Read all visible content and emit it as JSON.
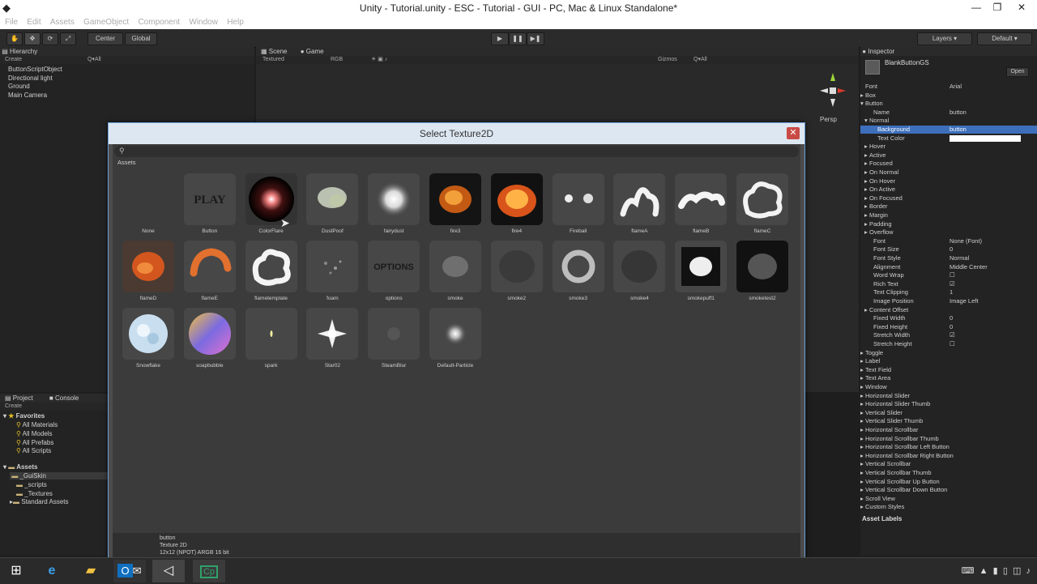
{
  "window": {
    "title": "Unity - Tutorial.unity - ESC - Tutorial - GUI - PC, Mac & Linux Standalone*",
    "menu": [
      "File",
      "Edit",
      "Assets",
      "GameObject",
      "Component",
      "Window",
      "Help"
    ]
  },
  "toolbar": {
    "pivot": "Center",
    "space": "Global",
    "layers": "Layers",
    "layout": "Default"
  },
  "hierarchy": {
    "tab": "Hierarchy",
    "create": "Create",
    "search_placeholder": "Q▾All",
    "items": [
      "ButtonScriptObject",
      "Directional light",
      "Ground",
      "Main Camera"
    ]
  },
  "scene": {
    "tab_scene": "Scene",
    "tab_game": "Game",
    "textured": "Textured",
    "rgb": "RGB",
    "gizmos": "Gizmos",
    "search": "Q▾All",
    "persp": "Persp"
  },
  "project": {
    "tab_project": "Project",
    "tab_console": "Console",
    "create": "Create",
    "favorites_label": "Favorites",
    "favorites": [
      "All Materials",
      "All Models",
      "All Prefabs",
      "All Scripts"
    ],
    "assets_label": "Assets",
    "assets": [
      "_GuiSkin",
      "_scripts",
      "_Textures",
      "Standard Assets"
    ]
  },
  "inspector": {
    "tab": "Inspector",
    "object_name": "BlankButtonGS",
    "open_button": "Open",
    "rows": [
      {
        "k": "Font",
        "v": "Arial",
        "indent": 0,
        "arrow": ""
      },
      {
        "k": "Box",
        "v": "",
        "indent": 0,
        "arrow": "▸"
      },
      {
        "k": "Button",
        "v": "",
        "indent": 0,
        "arrow": "▾"
      },
      {
        "k": "Name",
        "v": "button",
        "indent": 2,
        "arrow": ""
      },
      {
        "k": "Normal",
        "v": "",
        "indent": 1,
        "arrow": "▾"
      },
      {
        "k": "Background",
        "v": "button",
        "indent": 3,
        "arrow": "",
        "sel": true
      },
      {
        "k": "Text Color",
        "v": "",
        "indent": 3,
        "arrow": "",
        "color": true
      },
      {
        "k": "Hover",
        "v": "",
        "indent": 1,
        "arrow": "▸"
      },
      {
        "k": "Active",
        "v": "",
        "indent": 1,
        "arrow": "▸"
      },
      {
        "k": "Focused",
        "v": "",
        "indent": 1,
        "arrow": "▸"
      },
      {
        "k": "On Normal",
        "v": "",
        "indent": 1,
        "arrow": "▸"
      },
      {
        "k": "On Hover",
        "v": "",
        "indent": 1,
        "arrow": "▸"
      },
      {
        "k": "On Active",
        "v": "",
        "indent": 1,
        "arrow": "▸"
      },
      {
        "k": "On Focused",
        "v": "",
        "indent": 1,
        "arrow": "▸"
      },
      {
        "k": "Border",
        "v": "",
        "indent": 1,
        "arrow": "▸"
      },
      {
        "k": "Margin",
        "v": "",
        "indent": 1,
        "arrow": "▸"
      },
      {
        "k": "Padding",
        "v": "",
        "indent": 1,
        "arrow": "▸"
      },
      {
        "k": "Overflow",
        "v": "",
        "indent": 1,
        "arrow": "▸"
      },
      {
        "k": "Font",
        "v": "None (Font)",
        "indent": 2,
        "arrow": ""
      },
      {
        "k": "Font Size",
        "v": "0",
        "indent": 2,
        "arrow": ""
      },
      {
        "k": "Font Style",
        "v": "Normal",
        "indent": 2,
        "arrow": ""
      },
      {
        "k": "Alignment",
        "v": "Middle Center",
        "indent": 2,
        "arrow": ""
      },
      {
        "k": "Word Wrap",
        "v": "☐",
        "indent": 2,
        "arrow": ""
      },
      {
        "k": "Rich Text",
        "v": "☑",
        "indent": 2,
        "arrow": ""
      },
      {
        "k": "Text Clipping",
        "v": "1",
        "indent": 2,
        "arrow": ""
      },
      {
        "k": "Image Position",
        "v": "Image Left",
        "indent": 2,
        "arrow": ""
      },
      {
        "k": "Content Offset",
        "v": "",
        "indent": 1,
        "arrow": "▸"
      },
      {
        "k": "Fixed Width",
        "v": "0",
        "indent": 2,
        "arrow": ""
      },
      {
        "k": "Fixed Height",
        "v": "0",
        "indent": 2,
        "arrow": ""
      },
      {
        "k": "Stretch Width",
        "v": "☑",
        "indent": 2,
        "arrow": ""
      },
      {
        "k": "Stretch Height",
        "v": "☐",
        "indent": 2,
        "arrow": ""
      },
      {
        "k": "Toggle",
        "v": "",
        "indent": 0,
        "arrow": "▸"
      },
      {
        "k": "Label",
        "v": "",
        "indent": 0,
        "arrow": "▸"
      },
      {
        "k": "Text Field",
        "v": "",
        "indent": 0,
        "arrow": "▸"
      },
      {
        "k": "Text Area",
        "v": "",
        "indent": 0,
        "arrow": "▸"
      },
      {
        "k": "Window",
        "v": "",
        "indent": 0,
        "arrow": "▸"
      },
      {
        "k": "Horizontal Slider",
        "v": "",
        "indent": 0,
        "arrow": "▸"
      },
      {
        "k": "Horizontal Slider Thumb",
        "v": "",
        "indent": 0,
        "arrow": "▸"
      },
      {
        "k": "Vertical Slider",
        "v": "",
        "indent": 0,
        "arrow": "▸"
      },
      {
        "k": "Vertical Slider Thumb",
        "v": "",
        "indent": 0,
        "arrow": "▸"
      },
      {
        "k": "Horizontal Scrollbar",
        "v": "",
        "indent": 0,
        "arrow": "▸"
      },
      {
        "k": "Horizontal Scrollbar Thumb",
        "v": "",
        "indent": 0,
        "arrow": "▸"
      },
      {
        "k": "Horizontal Scrollbar Left Button",
        "v": "",
        "indent": 0,
        "arrow": "▸"
      },
      {
        "k": "Horizontal Scrollbar Right Button",
        "v": "",
        "indent": 0,
        "arrow": "▸"
      },
      {
        "k": "Vertical Scrollbar",
        "v": "",
        "indent": 0,
        "arrow": "▸"
      },
      {
        "k": "Vertical Scrollbar Thumb",
        "v": "",
        "indent": 0,
        "arrow": "▸"
      },
      {
        "k": "Vertical Scrollbar Up Button",
        "v": "",
        "indent": 0,
        "arrow": "▸"
      },
      {
        "k": "Vertical Scrollbar Down Button",
        "v": "",
        "indent": 0,
        "arrow": "▸"
      },
      {
        "k": "Scroll View",
        "v": "",
        "indent": 0,
        "arrow": "▸"
      },
      {
        "k": "Custom Styles",
        "v": "",
        "indent": 0,
        "arrow": "▸"
      }
    ],
    "asset_labels": "Asset Labels"
  },
  "dialog": {
    "title": "Select Texture2D",
    "close": "✕",
    "section": "Assets",
    "items": [
      {
        "name": "None",
        "style": "none"
      },
      {
        "name": "Button",
        "style": "play"
      },
      {
        "name": "ColorFlare",
        "style": "flare"
      },
      {
        "name": "DustPoof",
        "style": "dust"
      },
      {
        "name": "fairydust",
        "style": "fairy"
      },
      {
        "name": "fire3",
        "style": "fire3"
      },
      {
        "name": "fire4",
        "style": "fire4"
      },
      {
        "name": "Fireball",
        "style": "fireball"
      },
      {
        "name": "flameA",
        "style": "flameA"
      },
      {
        "name": "flameB",
        "style": "flameB"
      },
      {
        "name": "flameC",
        "style": "flameC"
      },
      {
        "name": "flameD",
        "style": "flameD"
      },
      {
        "name": "flameE",
        "style": "flameE"
      },
      {
        "name": "flametemplate",
        "style": "flametemplate"
      },
      {
        "name": "foam",
        "style": "foam"
      },
      {
        "name": "options",
        "style": "options"
      },
      {
        "name": "smoke",
        "style": "smoke"
      },
      {
        "name": "smoke2",
        "style": "smoke2"
      },
      {
        "name": "smoke3",
        "style": "smoke3"
      },
      {
        "name": "smoke4",
        "style": "smoke4"
      },
      {
        "name": "smokepuff1",
        "style": "smokepuff1"
      },
      {
        "name": "smoketest2",
        "style": "smoketest2"
      },
      {
        "name": "Snowflake",
        "style": "snow"
      },
      {
        "name": "soapbubble",
        "style": "soap"
      },
      {
        "name": "spark",
        "style": "spark"
      },
      {
        "name": "Star02",
        "style": "star"
      },
      {
        "name": "SteamBlur",
        "style": "steam"
      },
      {
        "name": "Default-Particle",
        "style": "particle"
      }
    ],
    "footer": {
      "name": "button",
      "type": "Texture 2D",
      "info": "12x12 (NPOT)  ARGB 16 bit"
    }
  },
  "thumb_texts": {
    "play": "PLAY",
    "options": "OPTIONS"
  },
  "taskbar": {
    "apps": [
      "windows-start",
      "internet-explorer",
      "file-explorer",
      "outlook",
      "unity",
      "captivate"
    ],
    "captivate_label": "Cp",
    "outlook_label": "O"
  }
}
